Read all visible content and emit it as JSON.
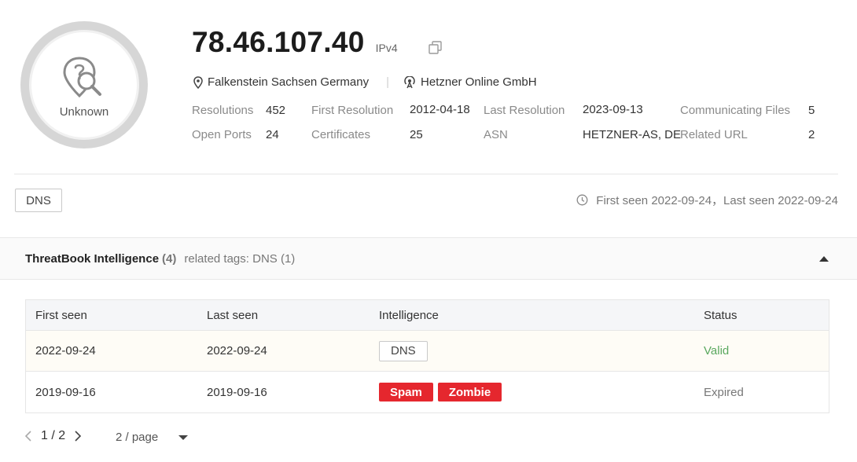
{
  "profile": {
    "avatar_label": "Unknown",
    "ip": "78.46.107.40",
    "ip_version": "IPv4",
    "location": "Falkenstein Sachsen Germany",
    "separator": "|",
    "isp": "Hetzner Online GmbH"
  },
  "stats": {
    "resolutions_label": "Resolutions",
    "resolutions_value": "452",
    "first_resolution_label": "First Resolution",
    "first_resolution_value": "2012-04-18",
    "last_resolution_label": "Last Resolution",
    "last_resolution_value": "2023-09-13",
    "communicating_files_label": "Communicating Files",
    "communicating_files_value": "5",
    "open_ports_label": "Open Ports",
    "open_ports_value": "24",
    "certificates_label": "Certificates",
    "certificates_value": "25",
    "asn_label": "ASN",
    "asn_value": "HETZNER-AS, DE",
    "related_url_label": "Related URL",
    "related_url_value": "2"
  },
  "top_tag": "DNS",
  "seen_summary": "First seen 2022-09-24，Last seen 2022-09-24",
  "intel": {
    "title": "ThreatBook Intelligence",
    "count": "(4)",
    "related_tags": "related tags: DNS (1)",
    "columns": [
      "First seen",
      "Last seen",
      "Intelligence",
      "Status"
    ],
    "rows": [
      {
        "first_seen": "2022-09-24",
        "last_seen": "2022-09-24",
        "tags": [
          "DNS"
        ],
        "status": "Valid"
      },
      {
        "first_seen": "2019-09-16",
        "last_seen": "2019-09-16",
        "tags": [
          "Spam",
          "Zombie"
        ],
        "status": "Expired"
      }
    ]
  },
  "pagination": {
    "current": "1 / 2",
    "page_size": "2 / page"
  },
  "colors": {
    "valid": "#5aa85f",
    "danger_tag": "#e5272e"
  }
}
